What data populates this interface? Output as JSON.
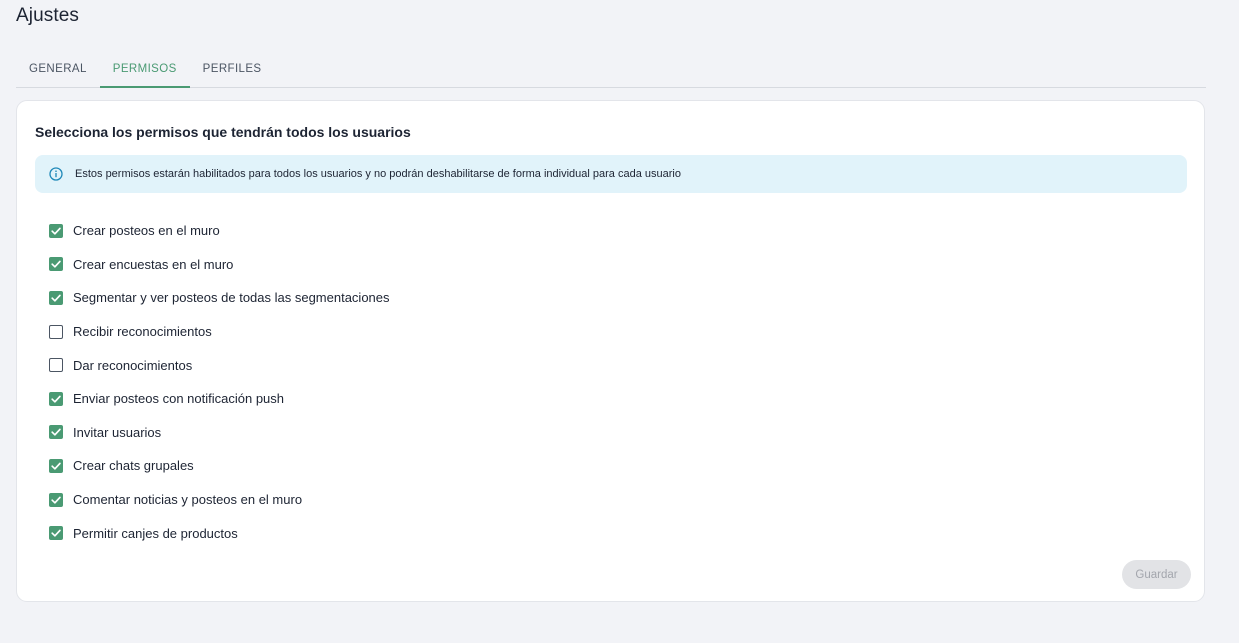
{
  "page": {
    "title": "Ajustes"
  },
  "tabs": [
    {
      "label": "GENERAL",
      "active": false
    },
    {
      "label": "PERMISOS",
      "active": true
    },
    {
      "label": "PERFILES",
      "active": false
    }
  ],
  "card": {
    "title": "Selecciona los permisos que tendrán todos los usuarios",
    "info": {
      "icon": "info-icon",
      "text": "Estos permisos estarán habilitados para todos los usuarios y no podrán deshabilitarse de forma individual para cada usuario"
    },
    "permissions": [
      {
        "label": "Crear posteos en el muro",
        "checked": true
      },
      {
        "label": "Crear encuestas en el muro",
        "checked": true
      },
      {
        "label": "Segmentar y ver posteos de todas las segmentaciones",
        "checked": true
      },
      {
        "label": "Recibir reconocimientos",
        "checked": false
      },
      {
        "label": "Dar reconocimientos",
        "checked": false
      },
      {
        "label": "Enviar posteos con notificación push",
        "checked": true
      },
      {
        "label": "Invitar usuarios",
        "checked": true
      },
      {
        "label": "Crear chats grupales",
        "checked": true
      },
      {
        "label": "Comentar noticias y posteos en el muro",
        "checked": true
      },
      {
        "label": "Permitir canjes de productos",
        "checked": true
      }
    ],
    "save_label": "Guardar",
    "save_disabled": true
  },
  "colors": {
    "accent": "#4a9a73",
    "background": "#f2f3f7",
    "info_background": "#e1f3fa",
    "info_icon": "#1e88b8"
  }
}
